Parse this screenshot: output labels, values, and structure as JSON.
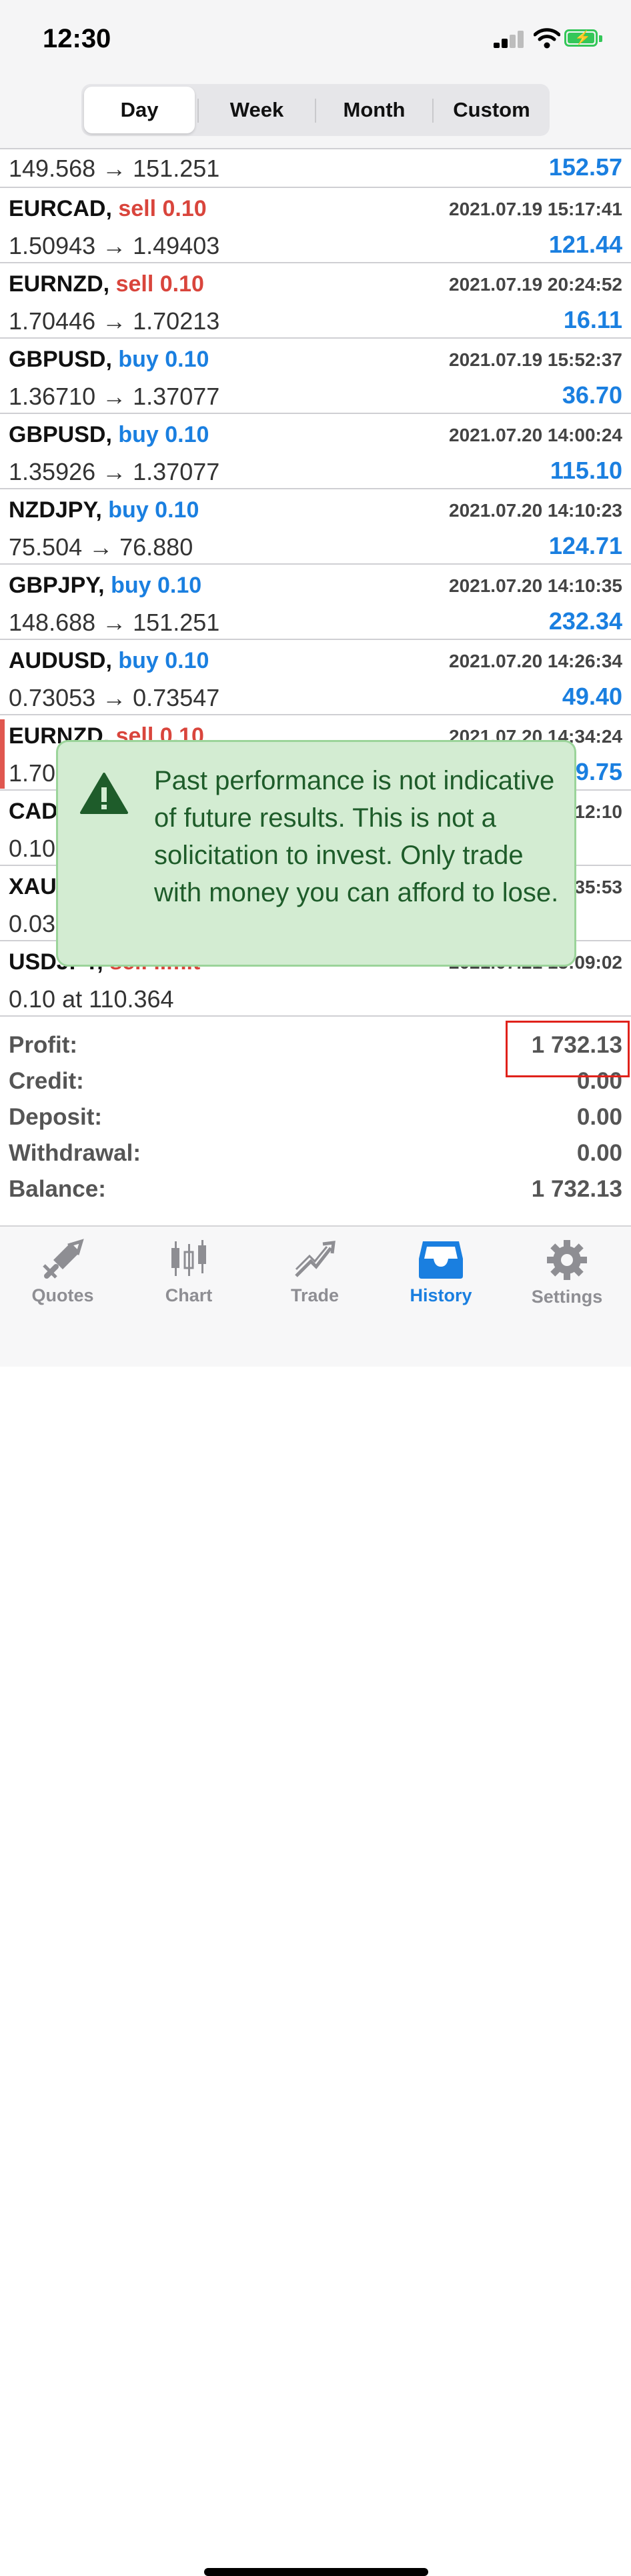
{
  "status_bar": {
    "time": "12:30"
  },
  "period_tabs": [
    {
      "label": "Day",
      "active": true
    },
    {
      "label": "Week",
      "active": false
    },
    {
      "label": "Month",
      "active": false
    },
    {
      "label": "Custom",
      "active": false
    }
  ],
  "first_row": {
    "price": "149.568 → 151.251",
    "profit": "152.57"
  },
  "trades": [
    {
      "symbol": "EURCAD,",
      "side": "sell 0.10",
      "side_type": "sell",
      "date": "2021.07.19 15:17:41",
      "price": "1.50943 → 1.49403",
      "profit": "121.44"
    },
    {
      "symbol": "EURNZD,",
      "side": "sell 0.10",
      "side_type": "sell",
      "date": "2021.07.19 20:24:52",
      "price": "1.70446 → 1.70213",
      "profit": "16.11"
    },
    {
      "symbol": "GBPUSD,",
      "side": "buy 0.10",
      "side_type": "buy",
      "date": "2021.07.19 15:52:37",
      "price": "1.36710 → 1.37077",
      "profit": "36.70"
    },
    {
      "symbol": "GBPUSD,",
      "side": "buy 0.10",
      "side_type": "buy",
      "date": "2021.07.20 14:00:24",
      "price": "1.35926 → 1.37077",
      "profit": "115.10"
    },
    {
      "symbol": "NZDJPY,",
      "side": "buy 0.10",
      "side_type": "buy",
      "date": "2021.07.20 14:10:23",
      "price": "75.504 → 76.880",
      "profit": "124.71"
    },
    {
      "symbol": "GBPJPY,",
      "side": "buy 0.10",
      "side_type": "buy",
      "date": "2021.07.20 14:10:35",
      "price": "148.688 → 151.251",
      "profit": "232.34"
    },
    {
      "symbol": "AUDUSD,",
      "side": "buy 0.10",
      "side_type": "buy",
      "date": "2021.07.20 14:26:34",
      "price": "0.73053 → 0.73547",
      "profit": "49.40"
    },
    {
      "symbol": "EURNZD,",
      "side": "sell 0.10",
      "side_type": "sell",
      "date": "2021.07.20 14:34:24",
      "price": "1.70",
      "profit": "9.75"
    },
    {
      "symbol": "CADC",
      "side": "",
      "side_type": "sell",
      "date": "12:10",
      "price": "0.10",
      "profit": ""
    },
    {
      "symbol": "XAUL",
      "side": "",
      "side_type": "sell",
      "date": "35:53",
      "price": "0.03",
      "profit": ""
    },
    {
      "symbol": "USDJPY,",
      "side": "sell limit",
      "side_type": "sell",
      "date": "2021.07.21 15:09:02",
      "price": "0.10 at 110.364",
      "profit": ""
    }
  ],
  "disclaimer": {
    "text": "Past performance is not indicative of future results. This is not a solicitation to invest. Only trade with money you can afford to lose."
  },
  "summary": {
    "profit_label": "Profit:",
    "profit": "1 732.13",
    "credit_label": "Credit:",
    "credit": "0.00",
    "deposit_label": "Deposit:",
    "deposit": "0.00",
    "withdrawal_label": "Withdrawal:",
    "withdrawal": "0.00",
    "balance_label": "Balance:",
    "balance": "1 732.13"
  },
  "tab_bar": [
    {
      "label": "Quotes",
      "icon": "quotes-icon",
      "active": false
    },
    {
      "label": "Chart",
      "icon": "chart-icon",
      "active": false
    },
    {
      "label": "Trade",
      "icon": "trade-icon",
      "active": false
    },
    {
      "label": "History",
      "icon": "history-icon",
      "active": true
    },
    {
      "label": "Settings",
      "icon": "gear-icon",
      "active": false
    }
  ],
  "colors": {
    "buy": "#1a7fe0",
    "sell": "#d9453c",
    "accent": "#1a7fe0",
    "highlight_box": "#e0221b",
    "disclaimer_bg": "#d3ecd2"
  }
}
